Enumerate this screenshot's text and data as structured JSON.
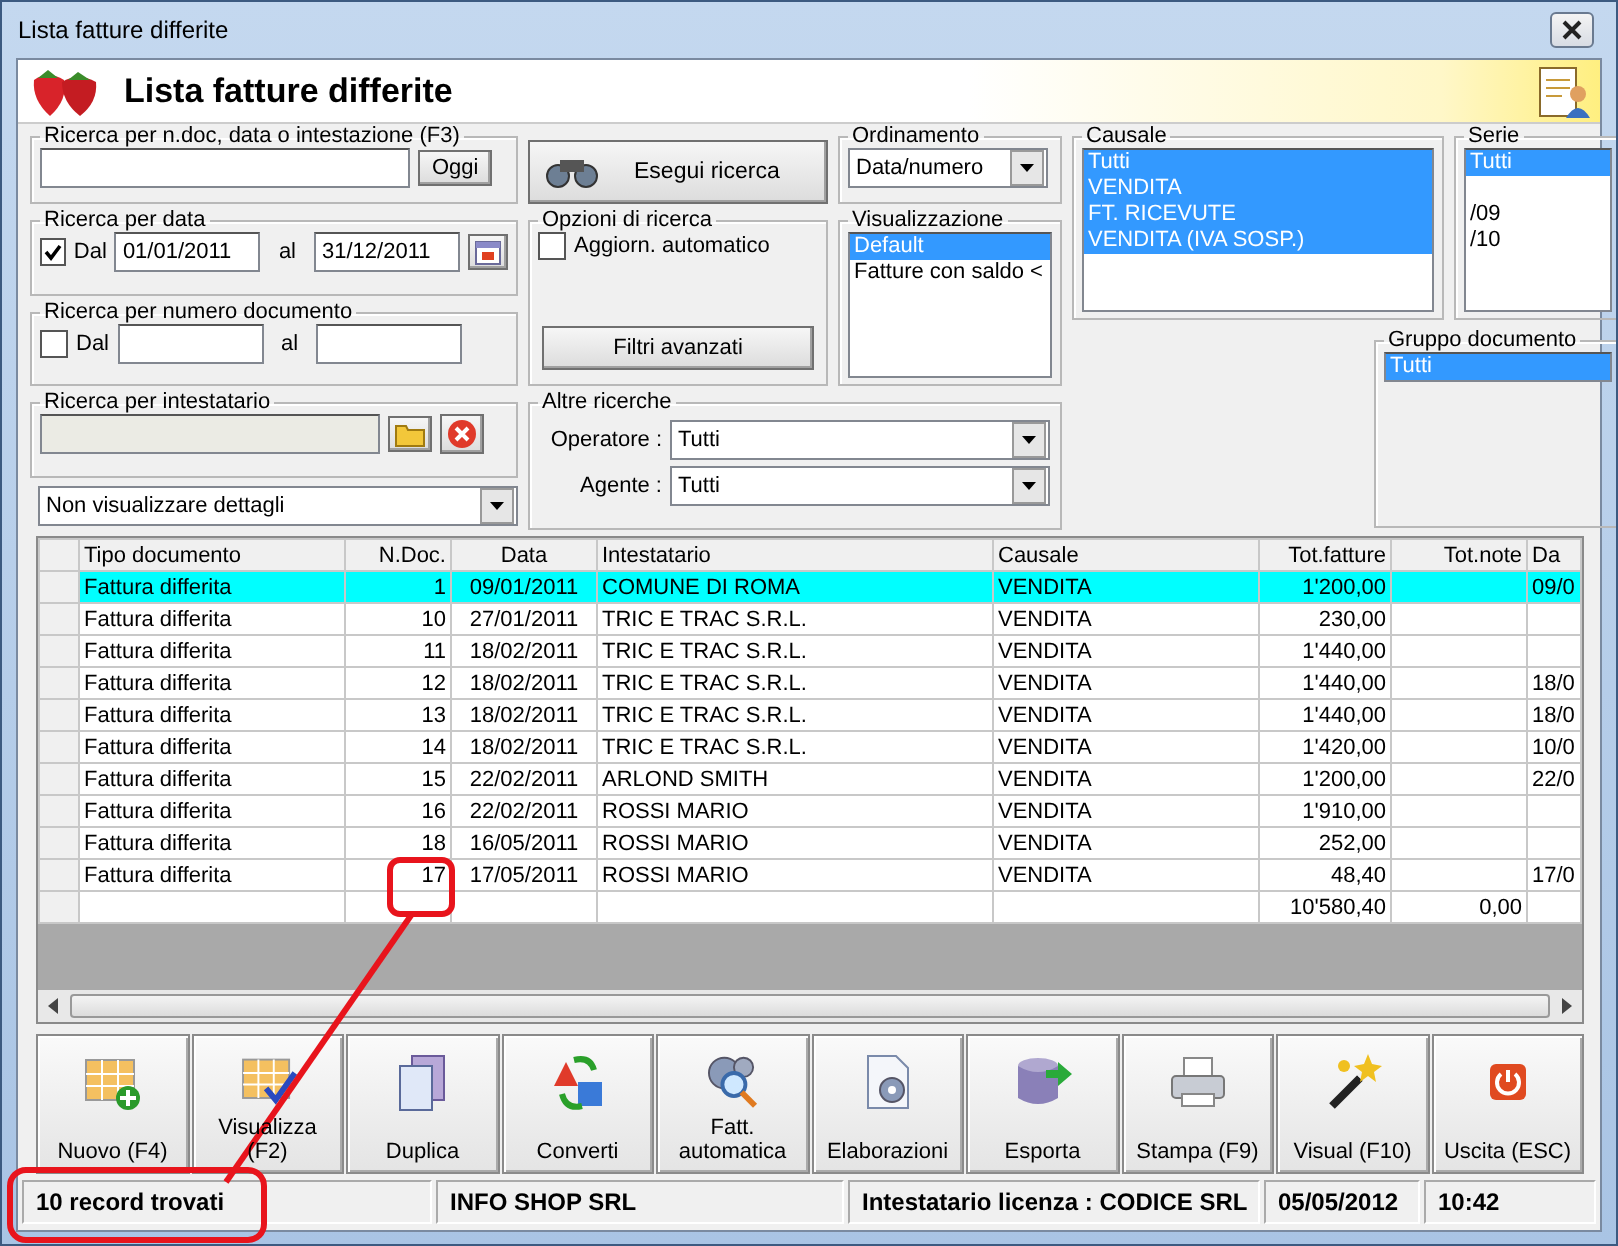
{
  "window": {
    "title": "Lista fatture differite"
  },
  "header": {
    "title": "Lista fatture differite"
  },
  "quick_search": {
    "legend": "Ricerca per n.doc, data o intestazione (F3)",
    "button": "Oggi"
  },
  "search_button": "Esegui ricerca",
  "ordering": {
    "legend": "Ordinamento",
    "value": "Data/numero"
  },
  "date_search": {
    "legend": "Ricerca per data",
    "checked": true,
    "from_label": "Dal",
    "from": "01/01/2011",
    "to_label": "al",
    "to": "31/12/2011"
  },
  "doc_number_search": {
    "legend": "Ricerca per numero documento",
    "checked": false,
    "from_label": "Dal",
    "to_label": "al"
  },
  "search_options": {
    "legend": "Opzioni di ricerca",
    "auto_update": {
      "label": "Aggiorn. automatico",
      "checked": false
    },
    "button": "Filtri avanzati"
  },
  "view": {
    "legend": "Visualizzazione",
    "items": [
      {
        "label": "Default",
        "selected": true
      },
      {
        "label": "Fatture con saldo <",
        "selected": false
      }
    ]
  },
  "holder_search": {
    "legend": "Ricerca per intestatario"
  },
  "details_dropdown": {
    "value": "Non visualizzare dettagli"
  },
  "other_search": {
    "legend": "Altre ricerche",
    "fields": [
      {
        "label": "Operatore :",
        "value": "Tutti"
      },
      {
        "label": "Agente :",
        "value": "Tutti"
      }
    ]
  },
  "causale": {
    "legend": "Causale",
    "items": [
      {
        "label": "Tutti",
        "selected": true
      },
      {
        "label": "VENDITA",
        "selected": true
      },
      {
        "label": "FT. RICEVUTE",
        "selected": true
      },
      {
        "label": "VENDITA (IVA SOSP.)",
        "selected": true
      }
    ]
  },
  "serie": {
    "legend": "Serie",
    "items": [
      {
        "kind": "text",
        "label": "Tutti",
        "selected": true
      },
      {
        "kind": "blank"
      },
      {
        "kind": "text",
        "label": "/09",
        "selected": false
      },
      {
        "kind": "text",
        "label": "/10",
        "selected": false
      }
    ]
  },
  "document_group": {
    "legend": "Gruppo documento",
    "items": [
      {
        "label": "Tutti",
        "selected": true
      }
    ]
  },
  "table": {
    "columns": [
      "Tipo documento",
      "N.Doc.",
      "Data",
      "Intestatario",
      "Causale",
      "Tot.fatture",
      "Tot.note",
      "Da"
    ],
    "rows": [
      {
        "selected": true,
        "tipo": "Fattura differita",
        "n_doc": "1",
        "data": "09/01/2011",
        "intestatario": "COMUNE DI ROMA",
        "causale": "VENDITA",
        "tot_fatture": "1'200,00",
        "column_8": "09/0"
      },
      {
        "selected": false,
        "tipo": "Fattura differita",
        "n_doc": "10",
        "data": "27/01/2011",
        "intestatario": "TRIC E TRAC S.R.L.",
        "causale": "VENDITA",
        "tot_fatture": "230,00"
      },
      {
        "selected": false,
        "tipo": "Fattura differita",
        "n_doc": "11",
        "data": "18/02/2011",
        "intestatario": "TRIC E TRAC S.R.L.",
        "causale": "VENDITA",
        "tot_fatture": "1'440,00"
      },
      {
        "selected": false,
        "tipo": "Fattura differita",
        "n_doc": "12",
        "data": "18/02/2011",
        "intestatario": "TRIC E TRAC S.R.L.",
        "causale": "VENDITA",
        "tot_fatture": "1'440,00",
        "column_8": "18/0"
      },
      {
        "selected": false,
        "tipo": "Fattura differita",
        "n_doc": "13",
        "data": "18/02/2011",
        "intestatario": "TRIC E TRAC S.R.L.",
        "causale": "VENDITA",
        "tot_fatture": "1'440,00",
        "column_8": "18/0"
      },
      {
        "selected": false,
        "tipo": "Fattura differita",
        "n_doc": "14",
        "data": "18/02/2011",
        "intestatario": "TRIC E TRAC S.R.L.",
        "causale": "VENDITA",
        "tot_fatture": "1'420,00",
        "column_8": "10/0"
      },
      {
        "selected": false,
        "tipo": "Fattura differita",
        "n_doc": "15",
        "data": "22/02/2011",
        "intestatario": "ARLOND SMITH",
        "causale": "VENDITA",
        "tot_fatture": "1'200,00",
        "column_8": "22/0"
      },
      {
        "selected": false,
        "tipo": "Fattura differita",
        "n_doc": "16",
        "data": "22/02/2011",
        "intestatario": "ROSSI MARIO",
        "causale": "VENDITA",
        "tot_fatture": "1'910,00"
      },
      {
        "selected": false,
        "tipo": "Fattura differita",
        "n_doc": "18",
        "data": "16/05/2011",
        "intestatario": "ROSSI MARIO",
        "causale": "VENDITA",
        "tot_fatture": "252,00"
      },
      {
        "selected": false,
        "tipo": "Fattura differita",
        "n_doc": "17",
        "data": "17/05/2011",
        "intestatario": "ROSSI MARIO",
        "causale": "VENDITA",
        "tot_fatture": "48,40",
        "column_8": "17/0"
      }
    ],
    "total_row": {
      "tot_fatture": "10'580,40",
      "tot_note": "0,00"
    }
  },
  "toolbar": [
    "Nuovo (F4)",
    "Visualizza (F2)",
    "Duplica",
    "Converti",
    "Fatt. automatica",
    "Elaborazioni",
    "Esporta",
    "Stampa (F9)",
    "Visual (F10)",
    "Uscita (ESC)"
  ],
  "status_bar": [
    "10 record trovati",
    "INFO SHOP SRL",
    "Intestatario licenza : CODICE SRL",
    "05/05/2012",
    "10:42"
  ]
}
